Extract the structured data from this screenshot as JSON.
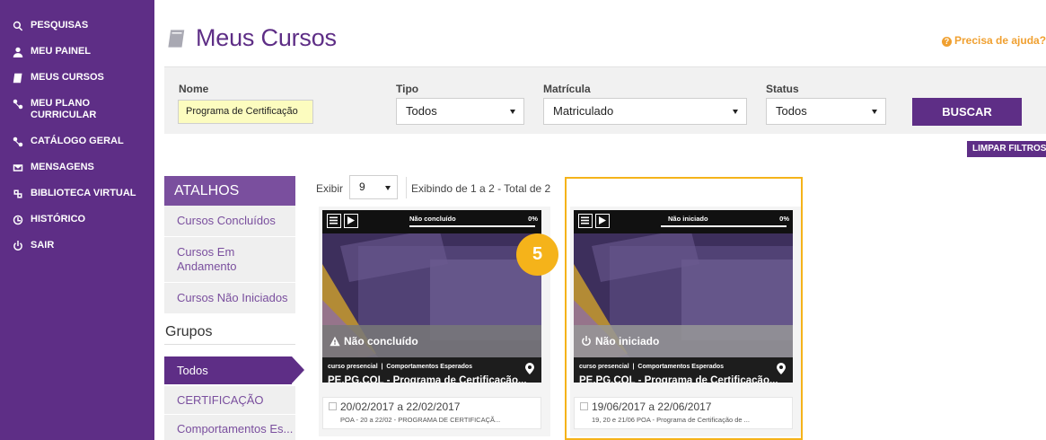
{
  "sidebar": {
    "items": [
      {
        "label": "PESQUISAS",
        "icon": "search-icon"
      },
      {
        "label": "MEU PAINEL",
        "icon": "user-icon"
      },
      {
        "label": "MEUS CURSOS",
        "icon": "book-icon"
      },
      {
        "label": "MEU PLANO CURRICULAR",
        "icon": "sitemap-icon"
      },
      {
        "label": "CATÁLOGO GERAL",
        "icon": "sitemap-icon"
      },
      {
        "label": "MENSAGENS",
        "icon": "envelope-icon"
      },
      {
        "label": "BIBLIOTECA VIRTUAL",
        "icon": "library-icon"
      },
      {
        "label": "HISTÓRICO",
        "icon": "clock-icon"
      },
      {
        "label": "SAIR",
        "icon": "power-icon"
      }
    ]
  },
  "header": {
    "title": "Meus Cursos",
    "help": "Precisa de ajuda?"
  },
  "filters": {
    "nome_label": "Nome",
    "nome_value": "Programa de Certificação",
    "tipo_label": "Tipo",
    "tipo_value": "Todos",
    "matricula_label": "Matrícula",
    "matricula_value": "Matriculado",
    "status_label": "Status",
    "status_value": "Todos",
    "buscar": "BUSCAR",
    "limpar": "LIMPAR FILTROS"
  },
  "atalhos": {
    "title": "ATALHOS",
    "items": [
      "Cursos Concluídos",
      "Cursos Em Andamento",
      "Cursos Não Iniciados"
    ]
  },
  "grupos": {
    "title": "Grupos",
    "items": [
      "Todos",
      "CERTIFICAÇÃO",
      "Comportamentos Es..."
    ]
  },
  "listing": {
    "exibir_label": "Exibir",
    "per_page": "9",
    "summary": "Exibindo de 1 a 2 - Total de 2"
  },
  "cards": [
    {
      "status_small": "Não concluído",
      "percent": "0%",
      "progress": 0,
      "status": "Não concluído",
      "type": "curso presencial",
      "category": "Comportamentos Esperados",
      "title": "PE.PG.COL - Programa de Certificação...",
      "dates": "20/02/2017 a 22/02/2017",
      "desc": "POA - 20 a 22/02 - PROGRAMA DE CERTIFICAÇÃ..."
    },
    {
      "status_small": "Não iniciado",
      "percent": "0%",
      "progress": 0,
      "status": "Não iniciado",
      "type": "curso presencial",
      "category": "Comportamentos Esperados",
      "title": "PE.PG.COL - Programa de Certificação...",
      "dates": "19/06/2017 a 22/06/2017",
      "desc": "19, 20 e 21/06 POA - Programa de Certificação de ..."
    }
  ],
  "step_badge": "5",
  "colors": {
    "brand": "#5e2e86",
    "accent": "#f5b31a",
    "help": "#f0a030"
  }
}
